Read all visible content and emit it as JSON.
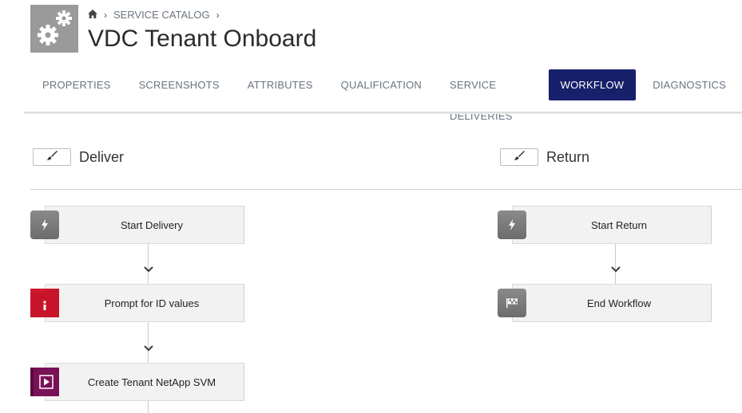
{
  "header": {
    "breadcrumb": {
      "home_icon": "home-icon",
      "section": "SERVICE CATALOG"
    },
    "title": "VDC Tenant Onboard",
    "icon": "gears-icon"
  },
  "tabs": [
    {
      "label": "PROPERTIES",
      "active": false
    },
    {
      "label": "SCREENSHOTS",
      "active": false
    },
    {
      "label": "ATTRIBUTES",
      "active": false
    },
    {
      "label": "QUALIFICATION",
      "active": false
    },
    {
      "label": "SERVICE DELIVERIES",
      "active": false
    },
    {
      "label": "WORKFLOW",
      "active": true
    },
    {
      "label": "DIAGNOSTICS",
      "active": false
    }
  ],
  "deliver": {
    "title": "Deliver",
    "nodes": [
      {
        "label": "Start Delivery",
        "icon": "lightning-icon"
      },
      {
        "label": "Prompt for ID values",
        "icon": "info-icon"
      },
      {
        "label": "Create Tenant NetApp SVM",
        "icon": "play-icon"
      }
    ]
  },
  "return": {
    "title": "Return",
    "nodes": [
      {
        "label": "Start Return",
        "icon": "lightning-icon"
      },
      {
        "label": "End Workflow",
        "icon": "flag-icon"
      }
    ]
  },
  "colors": {
    "active_tab": "#16206b",
    "node_bg": "#f2f2f2",
    "info_red": "#c8142b",
    "play_purple": "#7a1156"
  }
}
